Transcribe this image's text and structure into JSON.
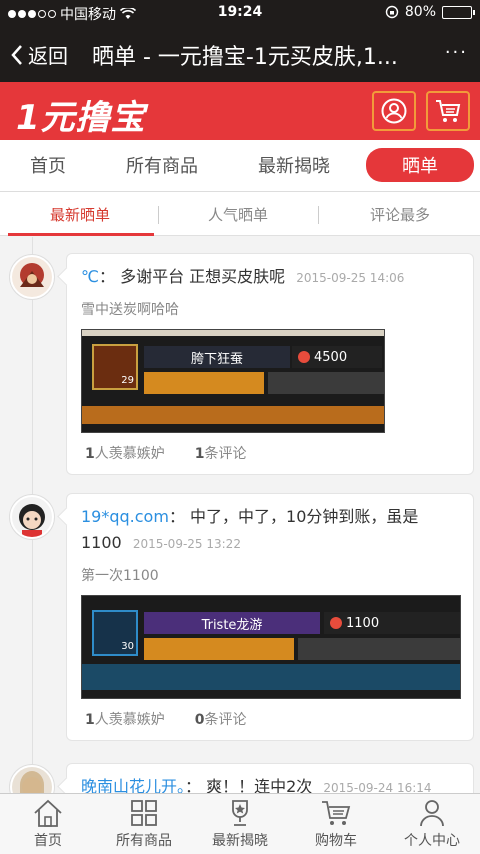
{
  "status": {
    "carrier": "中国移动",
    "time": "19:24",
    "battery": "80%",
    "battery_level": 0.8
  },
  "nav": {
    "back_label": "返回",
    "title": "晒单 - 一元撸宝-1元买皮肤,1...",
    "more": "···"
  },
  "brand": {
    "logo_text": "1元撸宝"
  },
  "category_tabs": [
    {
      "label": "首页"
    },
    {
      "label": "所有商品"
    },
    {
      "label": "最新揭晓"
    },
    {
      "label": "晒单",
      "active": true
    }
  ],
  "sub_tabs": [
    {
      "label": "最新晒单",
      "active": true
    },
    {
      "label": "人气晒单"
    },
    {
      "label": "评论最多"
    }
  ],
  "posts": [
    {
      "user": "℃",
      "text": "多谢平台 正想买皮肤呢",
      "time": "2015-09-25 14:06",
      "subtitle": "雪中送炭啊哈哈",
      "shot": {
        "player": "胯下狂蚕",
        "score": "4500",
        "level": "29"
      },
      "likes_count": "1",
      "likes_label": "人羡慕嫉妒",
      "comments_count": "1",
      "comments_label": "条评论"
    },
    {
      "user": "19*qq.com",
      "text": "中了，中了，10分钟到账，虽是1100",
      "time": "2015-09-25 13:22",
      "subtitle": "第一次1100",
      "shot": {
        "player": "Triste龙游",
        "score": "1100",
        "level": "30"
      },
      "likes_count": "1",
      "likes_label": "人羡慕嫉妒",
      "comments_count": "0",
      "comments_label": "条评论"
    },
    {
      "user": "晚南山花儿开。",
      "text": "爽！！连中2次",
      "time": "2015-09-24 16:14"
    }
  ],
  "bottom_tabs": [
    {
      "label": "首页",
      "icon": "home-icon"
    },
    {
      "label": "所有商品",
      "icon": "grid-icon"
    },
    {
      "label": "最新揭晓",
      "icon": "trophy-icon"
    },
    {
      "label": "购物车",
      "icon": "cart-icon"
    },
    {
      "label": "个人中心",
      "icon": "person-icon"
    }
  ],
  "colors": {
    "brand_red": "#e5373a",
    "dark": "#1f1c1b",
    "link_blue": "#2b8fe0"
  }
}
